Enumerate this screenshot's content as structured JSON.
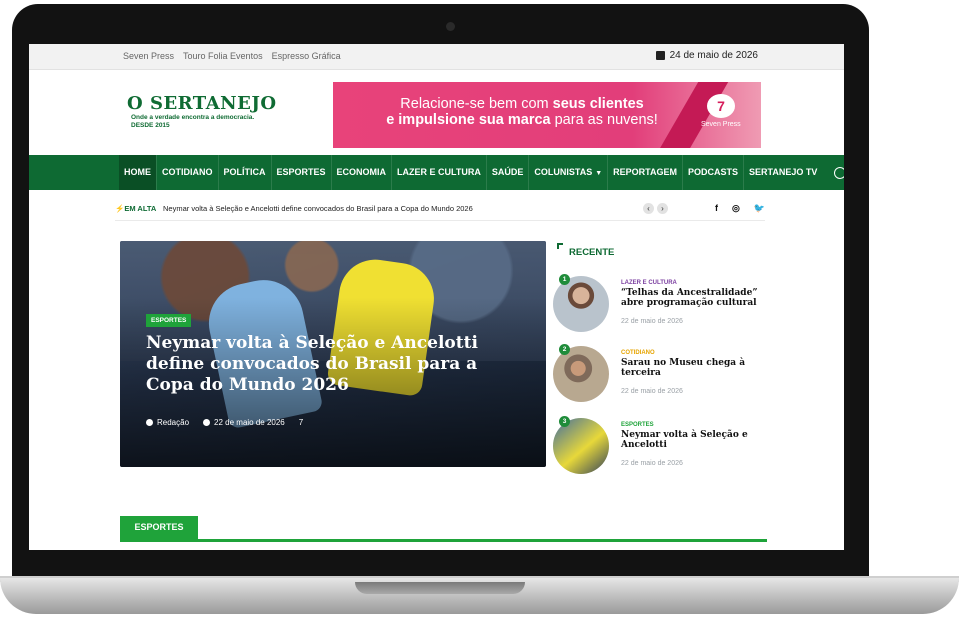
{
  "topbar": {
    "links": [
      "Seven Press",
      "Touro Folia Eventos",
      "Espresso Gráfica"
    ],
    "date": "24 de maio de 2026"
  },
  "logo": {
    "title": "O SERTANEJO",
    "tagline_1": "Onde a verdade encontra a democracia.",
    "tagline_2": "DESDE 2015"
  },
  "banner": {
    "line1_pre": "Relacione-se bem com ",
    "line1_bold": "seus clientes",
    "line2_bold": "e impulsione sua marca",
    "line2_post": " para as nuvens!",
    "brand": "Seven Press"
  },
  "nav": {
    "items": [
      "HOME",
      "COTIDIANO",
      "POLÍTICA",
      "ESPORTES",
      "ECONOMIA",
      "LAZER E CULTURA",
      "SAÚDE",
      "COLUNISTAS",
      "REPORTAGEM",
      "PODCASTS",
      "SERTANEJO TV"
    ],
    "active": "HOME",
    "colors": {
      "bar": "#0e6a33",
      "active": "#0a4f25"
    }
  },
  "ticker": {
    "label": "EM ALTA",
    "text": "Neymar volta à Seleção e Ancelotti define convocados do Brasil para a Copa do Mundo 2026",
    "social": [
      "f",
      "◎",
      "🐦"
    ]
  },
  "hero": {
    "category": "ESPORTES",
    "title": "Neymar volta à Seleção e Ancelotti define convocados do Brasil para a Copa do Mundo 2026",
    "author": "Redação",
    "date": "22 de maio de 2026",
    "comments": "7"
  },
  "recent": {
    "title": "RECENTE",
    "items": [
      {
        "num": "1",
        "category": "LAZER E CULTURA",
        "cat_color": "#7b3fa0",
        "title": "“Telhas da Ancestralidade” abre programação cultural",
        "date": "22 de maio de 2026"
      },
      {
        "num": "2",
        "category": "COTIDIANO",
        "cat_color": "#e6a400",
        "title": "Sarau no Museu chega à terceira",
        "date": "22 de maio de 2026"
      },
      {
        "num": "3",
        "category": "ESPORTES",
        "cat_color": "#1fa33a",
        "title": "Neymar volta à Seleção e Ancelotti",
        "date": "22 de maio de 2026"
      }
    ]
  },
  "section": {
    "label": "ESPORTES"
  },
  "accent": "#1fa33a"
}
